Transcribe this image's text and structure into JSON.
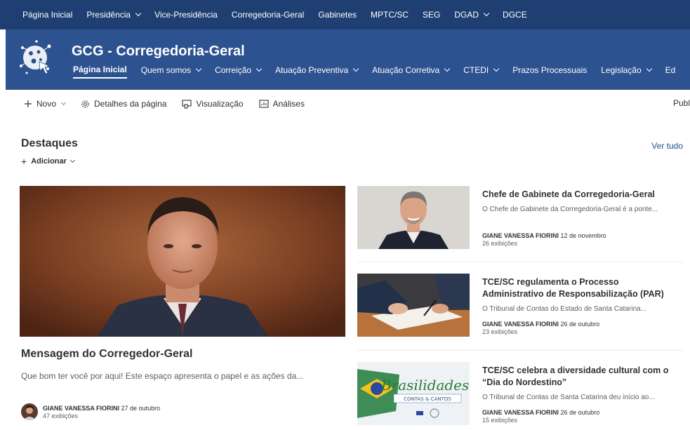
{
  "hubnav": {
    "items": [
      {
        "label": "Página Inicial",
        "dropdown": false
      },
      {
        "label": "Presidência",
        "dropdown": true
      },
      {
        "label": "Vice-Presidência",
        "dropdown": false
      },
      {
        "label": "Corregedoria-Geral",
        "dropdown": false
      },
      {
        "label": "Gabinetes",
        "dropdown": false
      },
      {
        "label": "MPTC/SC",
        "dropdown": false
      },
      {
        "label": "SEG",
        "dropdown": false
      },
      {
        "label": "DGAD",
        "dropdown": true
      },
      {
        "label": "DGCE",
        "dropdown": false
      }
    ]
  },
  "site": {
    "title": "GCG - Corregedoria-Geral",
    "nav": [
      {
        "label": "Página Inicial",
        "active": true,
        "dropdown": false
      },
      {
        "label": "Quem somos",
        "active": false,
        "dropdown": true
      },
      {
        "label": "Correição",
        "active": false,
        "dropdown": true
      },
      {
        "label": "Atuação Preventiva",
        "active": false,
        "dropdown": true
      },
      {
        "label": "Atuação Corretiva",
        "active": false,
        "dropdown": true
      },
      {
        "label": "CTEDI",
        "active": false,
        "dropdown": true
      },
      {
        "label": "Prazos Processuais",
        "active": false,
        "dropdown": false
      },
      {
        "label": "Legislação",
        "active": false,
        "dropdown": true
      },
      {
        "label": "Ed",
        "active": false,
        "dropdown": false
      }
    ]
  },
  "commandbar": {
    "new_label": "Novo",
    "page_details_label": "Detalhes da página",
    "preview_label": "Visualização",
    "analytics_label": "Análises",
    "publish_label": "Publ"
  },
  "highlights": {
    "title": "Destaques",
    "see_all": "Ver tudo",
    "add_label": "Adicionar",
    "main": {
      "title": "Mensagem do Corregedor-Geral",
      "description": "Que bom ter você por aqui! Este espaço apresenta o papel e as ações da...",
      "author": "GIANE VANESSA FIORINI",
      "date": "27 de outubro",
      "views": "47 exibições"
    },
    "items": [
      {
        "title": "Chefe de Gabinete da Corregedoria-Geral",
        "description": "O Chefe de Gabinete da Corregedoria-Geral é a ponte...",
        "author": "GIANE VANESSA FIORINI",
        "date": "12 de novembro",
        "views": "26 exibições"
      },
      {
        "title": "TCE/SC regulamenta o Processo Administrativo de Responsabilização (PAR)",
        "description": "O Tribunal de Contas do Estado de Santa Catarina...",
        "author": "GIANE VANESSA FIORINI",
        "date": "26 de outubro",
        "views": "23 exibições"
      },
      {
        "title": "TCE/SC celebra a diversidade cultural com o “Dia do Nordestino”",
        "description": "O Tribunal de Contas de Santa Catarina deu início ao...",
        "author": "GIANE VANESSA FIORINI",
        "date": "26 de outubro",
        "views": "15 exibições",
        "thumb_text": "Brasilidades",
        "thumb_subtext": "CONTAS & CANTOS"
      }
    ]
  },
  "colors": {
    "hub_bg": "#1f3f73",
    "site_bg": "#2d5290",
    "link": "#1f4e8c"
  }
}
